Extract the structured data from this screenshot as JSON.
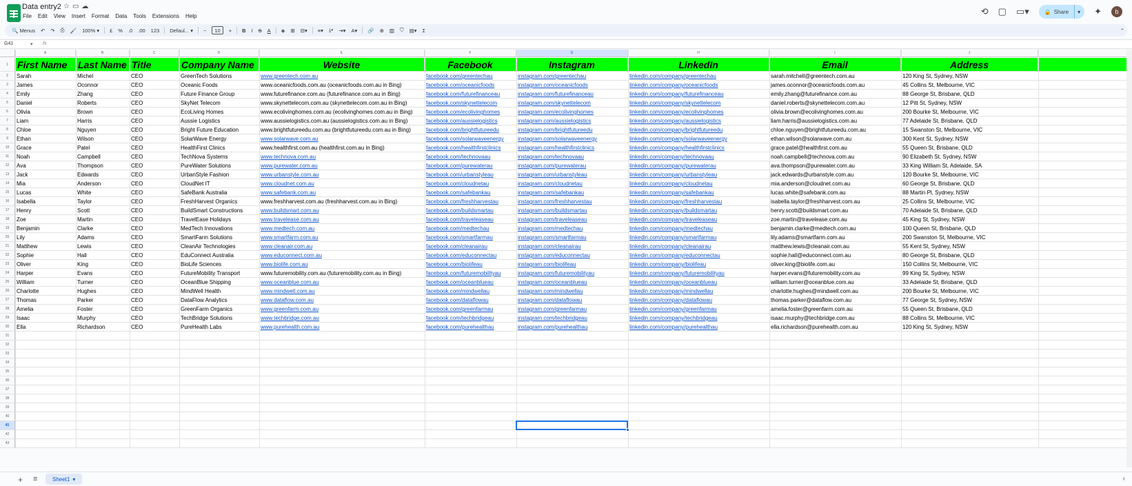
{
  "app": {
    "doc_title": "Data entry2",
    "menu": [
      "File",
      "Edit",
      "View",
      "Insert",
      "Format",
      "Data",
      "Tools",
      "Extensions",
      "Help"
    ],
    "share_label": "Share",
    "avatar_letter": "b"
  },
  "toolbar": {
    "search_label": "Menus",
    "zoom": "100%",
    "currency": "£",
    "percent": "%",
    "dec_less": ".0",
    "dec_more": ".00",
    "number_format": "123",
    "font": "Defaul...",
    "font_size": "10"
  },
  "formula_bar": {
    "cell_ref": "G41",
    "fx": "fx"
  },
  "columns": [
    {
      "letter": "A",
      "header": "First Name"
    },
    {
      "letter": "B",
      "header": "Last Name"
    },
    {
      "letter": "C",
      "header": "Title"
    },
    {
      "letter": "D",
      "header": "Company Name"
    },
    {
      "letter": "E",
      "header": "Website"
    },
    {
      "letter": "F",
      "header": "Facebook"
    },
    {
      "letter": "G",
      "header": "Instagram"
    },
    {
      "letter": "H",
      "header": "LinkedIn"
    },
    {
      "letter": "I",
      "header": "Email"
    },
    {
      "letter": "J",
      "header": "Address"
    }
  ],
  "rows": [
    [
      "Sarah",
      "Michel",
      "CEO",
      "GreenTech Solutions",
      "www.greentech.com.au",
      "facebook.com/greentechau",
      "instagram.com/greentechau",
      "linkedin.com/company/greentechau",
      "sarah.mitchell@greentech.com.au",
      "120 King St, Sydney, NSW"
    ],
    [
      "James",
      "Oconnor",
      "CEO",
      "Oceanic Foods",
      "www.oceanicfoods.com.au (oceanicfoods.com.au in Bing)",
      "facebook.com/oceanicfoods",
      "instagram.com/oceanicfoods",
      "linkedin.com/company/oceanicfoods",
      "james.oconnor@oceanicfoods.com.au",
      "45 Collins St, Melbourne, VIC"
    ],
    [
      "Emily",
      "Zhang",
      "CEO",
      "Future Finance Group",
      "www.futurefinance.com.au (futurefinance.com.au in Bing)",
      "facebook.com/futurefinanceau",
      "instagram.com/futurefinanceau",
      "linkedin.com/company/futurefinanceau",
      "emily.zhang@futurefinance.com.au",
      "88 George St, Brisbane, QLD"
    ],
    [
      "Daniel",
      "Roberts",
      "CEO",
      "SkyNet Telecom",
      "www.skynettelecom.com.au (skynettelecom.com.au in Bing)",
      "facebook.com/skynettelecom",
      "instagram.com/skynettelecom",
      "linkedin.com/company/skynettelecom",
      "daniel.roberts@skynettelecom.com.au",
      "12 Pitt St, Sydney, NSW"
    ],
    [
      "Olivia",
      "Brown",
      "CEO",
      "EcoLiving Homes",
      "www.ecolivinghomes.com.au (ecolivinghomes.com.au in Bing)",
      "facebook.com/ecolivinghomes",
      "instagram.com/ecolivinghomes",
      "linkedin.com/company/ecolivinghomes",
      "olivia.brown@ecolivinghomes.com.au",
      "200 Bourke St, Melbourne, VIC"
    ],
    [
      "Liam",
      "Harris",
      "CEO",
      "Aussie Logistics",
      "www.aussielogistics.com.au (aussielogistics.com.au in Bing)",
      "facebook.com/aussielogistics",
      "instagram.com/aussielogistics",
      "linkedin.com/company/aussielogistics",
      "liam.harris@aussielogistics.com.au",
      "77 Adelaide St, Brisbane, QLD"
    ],
    [
      "Chloe",
      "Nguyen",
      "CEO",
      "Bright Future Education",
      "www.brightfutureedu.com.au (brightfutureedu.com.au in Bing)",
      "facebook.com/brightfutureedu",
      "instagram.com/brightfutureedu",
      "linkedin.com/company/brightfutureedu",
      "chloe.nguyen@brightfutureedu.com.au",
      "15 Swanston St, Melbourne, VIC"
    ],
    [
      "Ethan",
      "Wilson",
      "CEO",
      "SolarWave Energy",
      "www.solarwave.com.au",
      "facebook.com/solarwaveenergy",
      "instagram.com/solarwaveenergy",
      "linkedin.com/company/solarwaveenergy",
      "ethan.wilson@solarwave.com.au",
      "300 Kent St, Sydney, NSW"
    ],
    [
      "Grace",
      "Patel",
      "CEO",
      "HealthFirst Clinics",
      "www.healthfirst.com.au (healthfirst.com.au in Bing)",
      "facebook.com/healthfirstclinics",
      "instagram.com/healthfirstclinics",
      "linkedin.com/company/healthfirstclinics",
      "grace.patel@healthfirst.com.au",
      "55 Queen St, Brisbane, QLD"
    ],
    [
      "Noah",
      "Campbell",
      "CEO",
      "TechNova Systems",
      "www.technova.com.au",
      "facebook.com/technovaau",
      "instagram.com/technovaau",
      "linkedin.com/company/technovaau",
      "noah.campbell@technova.com.au",
      "90 Elizabeth St, Sydney, NSW"
    ],
    [
      "Ava",
      "Thompson",
      "CEO",
      "PureWater Solutions",
      "www.purewater.com.au",
      "facebook.com/purewaterau",
      "instagram.com/purewaterau",
      "linkedin.com/company/purewaterau",
      "ava.thompson@purewater.com.au",
      "33 King William St, Adelaide, SA"
    ],
    [
      "Jack",
      "Edwards",
      "CEO",
      "UrbanStyle Fashion",
      "www.urbanstyle.com.au",
      "facebook.com/urbanstyleau",
      "instagram.com/urbanstyleau",
      "linkedin.com/company/urbanstyleau",
      "jack.edwards@urbanstyle.com.au",
      "120 Bourke St, Melbourne, VIC"
    ],
    [
      "Mia",
      "Anderson",
      "CEO",
      "CloudNet IT",
      "www.cloudnet.com.au",
      "facebook.com/cloudnetau",
      "instagram.com/cloudnetau",
      "linkedin.com/company/cloudnetau",
      "mia.anderson@cloudnet.com.au",
      "60 George St, Brisbane, QLD"
    ],
    [
      "Lucas",
      "White",
      "CEO",
      "SafeBank Australia",
      "www.safebank.com.au",
      "facebook.com/safebankau",
      "instagram.com/safebankau",
      "linkedin.com/company/safebankau",
      "lucas.white@safebank.com.au",
      "88 Martin Pl, Sydney, NSW"
    ],
    [
      "Isabella",
      "Taylor",
      "CEO",
      "FreshHarvest Organics",
      "www.freshharvest.com.au (freshharvest.com.au in Bing)",
      "facebook.com/freshharvestau",
      "instagram.com/freshharvestau",
      "linkedin.com/company/freshharvestau",
      "isabella.taylor@freshharvest.com.au",
      "25 Collins St, Melbourne, VIC"
    ],
    [
      "Henry",
      "Scott",
      "CEO",
      "BuildSmart Constructions",
      "www.buildsmart.com.au",
      "facebook.com/buildsmartau",
      "instagram.com/buildsmartau",
      "linkedin.com/company/buildsmartau",
      "henry.scott@buildsmart.com.au",
      "70 Adelaide St, Brisbane, QLD"
    ],
    [
      "Zoe",
      "Martin",
      "CEO",
      "TravelEase Holidays",
      "www.travelease.com.au",
      "facebook.com/traveleaseau",
      "instagram.com/traveleaseau",
      "linkedin.com/company/traveleaseau",
      "zoe.martin@travelease.com.au",
      "45 King St, Sydney, NSW"
    ],
    [
      "Benjamin",
      "Clarke",
      "CEO",
      "MedTech Innovations",
      "www.medtech.com.au",
      "facebook.com/medtechau",
      "instagram.com/medtechau",
      "linkedin.com/company/medtechau",
      "benjamin.clarke@medtech.com.au",
      "100 Queen St, Brisbane, QLD"
    ],
    [
      "Lily",
      "Adams",
      "CEO",
      "SmartFarm Solutions",
      "www.smartfarm.com.au",
      "facebook.com/smartfarmau",
      "instagram.com/smartfarmau",
      "linkedin.com/company/smartfarmau",
      "lily.adams@smartfarm.com.au",
      "200 Swanston St, Melbourne, VIC"
    ],
    [
      "Matthew",
      "Lewis",
      "CEO",
      "CleanAir Technologies",
      "www.cleanair.com.au",
      "facebook.com/cleanairau",
      "instagram.com/cleanairau",
      "linkedin.com/company/cleanairau",
      "matthew.lewis@cleanair.com.au",
      "55 Kent St, Sydney, NSW"
    ],
    [
      "Sophie",
      "Hall",
      "CEO",
      "EduConnect Australia",
      "www.educonnect.com.au",
      "facebook.com/educonnectau",
      "instagram.com/educonnectau",
      "linkedin.com/company/educonnectau",
      "sophie.hall@educonnect.com.au",
      "80 George St, Brisbane, QLD"
    ],
    [
      "Oliver",
      "King",
      "CEO",
      "BioLife Sciences",
      "www.biolife.com.au",
      "facebook.com/biolifeau",
      "instagram.com/biolifeau",
      "linkedin.com/company/biolifeau",
      "oliver.king@biolife.com.au",
      "150 Collins St, Melbourne, VIC"
    ],
    [
      "Harper",
      "Evans",
      "CEO",
      "FutureMobility Transport",
      "www.futuremobility.com.au (futuremobility.com.au in Bing)",
      "facebook.com/futuremobilityau",
      "instagram.com/futuremobilityau",
      "linkedin.com/company/futuremobilityau",
      "harper.evans@futuremobility.com.au",
      "99 King St, Sydney, NSW"
    ],
    [
      "William",
      "Turner",
      "CEO",
      "OceanBlue Shipping",
      "www.oceanblue.com.au",
      "facebook.com/oceanblueau",
      "instagram.com/oceanblueau",
      "linkedin.com/company/oceanblueau",
      "william.turner@oceanblue.com.au",
      "33 Adelaide St, Brisbane, QLD"
    ],
    [
      "Charlotte",
      "Hughes",
      "CEO",
      "MindWell Health",
      "www.mindwell.com.au",
      "facebook.com/mindwellau",
      "instagram.com/mindwellau",
      "linkedin.com/company/mindwellau",
      "charlotte.hughes@mindwell.com.au",
      "200 Bourke St, Melbourne, VIC"
    ],
    [
      "Thomas",
      "Parker",
      "CEO",
      "DataFlow Analytics",
      "www.dataflow.com.au",
      "facebook.com/dataflowau",
      "instagram.com/dataflowau",
      "linkedin.com/company/dataflowau",
      "thomas.parker@dataflow.com.au",
      "77 George St, Sydney, NSW"
    ],
    [
      "Amelia",
      "Foster",
      "CEO",
      "GreenFarm Organics",
      "www.greenfarm.com.au",
      "facebook.com/greenfarmau",
      "instagram.com/greenfarmau",
      "linkedin.com/company/greenfarmau",
      "amelia.foster@greenfarm.com.au",
      "55 Queen St, Brisbane, QLD"
    ],
    [
      "Isaac",
      "Murphy",
      "CEO",
      "TechBridge Solutions",
      "www.techbridge.com.au",
      "facebook.com/techbridgeau",
      "instagram.com/techbridgeau",
      "linkedin.com/company/techbridgeau",
      "isaac.murphy@techbridge.com.au",
      "88 Collins St, Melbourne, VIC"
    ],
    [
      "Ella",
      "Richardson",
      "CEO",
      "PureHealth Labs",
      "www.purehealth.com.au",
      "facebook.com/purehealthau",
      "instagram.com/purehealthau",
      "linkedin.com/company/purehealthau",
      "ella.richardson@purehealth.com.au",
      "120 King St, Sydney, NSW"
    ]
  ],
  "row_count": 45,
  "selected_row": 41,
  "selected_col": "G",
  "sheet_tab": "Sheet1",
  "colors": {
    "header_fill": "#00ff00",
    "link": "#1155cc",
    "selection": "#1a73e8"
  }
}
